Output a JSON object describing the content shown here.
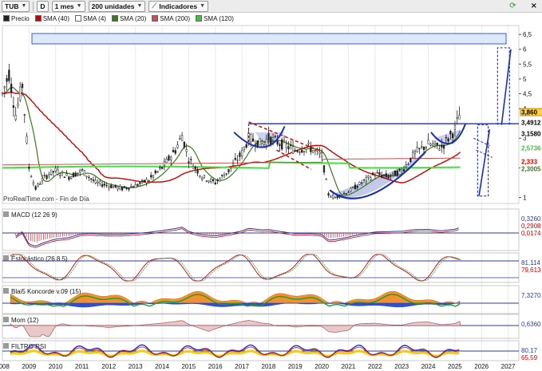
{
  "toolbar": {
    "symbol": "TUB",
    "d_button": "D",
    "period": "1 mes",
    "units": "200 unidades",
    "indicators": "Indicadores",
    "close_glyph": "×"
  },
  "legend": [
    {
      "label": "Precio",
      "color": "#222222"
    },
    {
      "label": "SMA (40)",
      "color": "#cc0000"
    },
    {
      "label": "SMA (4)",
      "color": "#ffffff"
    },
    {
      "label": "SMA (20)",
      "color": "#3a7a1a"
    },
    {
      "label": "SMA (200)",
      "color": "#c85050"
    },
    {
      "label": "SMA (120)",
      "color": "#40c040"
    }
  ],
  "watermark": "ProRealTime.com - Fin de Día",
  "price_axis": {
    "ticks": [
      "6,5",
      "6",
      "5,5",
      "5",
      "4,5",
      "4",
      "3",
      "2",
      "1"
    ],
    "labels": [
      {
        "text": "3,860",
        "color": "#000000",
        "bg": "#ffd040"
      },
      {
        "text": "3,4912",
        "color": "#000000",
        "bg": "#ffffff"
      },
      {
        "text": "3,1580",
        "color": "#000000",
        "bg": "#ffffff"
      },
      {
        "text": "2,5736",
        "color": "#40c040",
        "bg": "#ffffff"
      },
      {
        "text": "2,333",
        "color": "#cc0000",
        "bg": "#ffffff"
      },
      {
        "text": "2,3005",
        "color": "#3a7a1a",
        "bg": "#ffffff"
      }
    ]
  },
  "panels": {
    "macd": {
      "title": "MACD (12 26 9)",
      "labels": [
        "0,3260",
        "0,2908",
        "0,0174"
      ]
    },
    "stoch": {
      "title": "Estocástico (26 8 5)",
      "labels": [
        "81,114",
        "79,613"
      ]
    },
    "blai": {
      "title": "Blai5 Koncorde v.09 (15)",
      "labels": [
        "7,3270"
      ]
    },
    "mom": {
      "title": "Mom (12)",
      "labels": [
        "0,6360"
      ]
    },
    "rsi": {
      "title": "FILTRO RSI",
      "labels": [
        "80,17",
        "65,59"
      ]
    }
  },
  "x_axis": {
    "years": [
      "2008",
      "2009",
      "2010",
      "2011",
      "2012",
      "2013",
      "2014",
      "2015",
      "2016",
      "2017",
      "2018",
      "2019",
      "2020",
      "2021",
      "2022",
      "2023",
      "2024",
      "2025",
      "2026",
      "2027"
    ]
  },
  "chart_data": {
    "type": "line",
    "title": "TUB",
    "x": [
      2008.0,
      2008.25,
      2008.5,
      2008.75,
      2009.0,
      2009.25,
      2009.5,
      2009.75,
      2010.0,
      2010.5,
      2011.0,
      2011.5,
      2012.0,
      2012.5,
      2013.0,
      2013.5,
      2014.0,
      2014.5,
      2014.75,
      2015.0,
      2015.5,
      2016.0,
      2016.5,
      2017.0,
      2017.25,
      2017.5,
      2017.75,
      2018.0,
      2018.5,
      2019.0,
      2019.5,
      2020.0,
      2020.25,
      2020.5,
      2021.0,
      2021.5,
      2022.0,
      2022.5,
      2023.0,
      2023.5,
      2024.0,
      2024.5,
      2025.0,
      2025.2
    ],
    "series": [
      {
        "name": "Precio",
        "values": [
          4.5,
          5.2,
          3.8,
          4.8,
          2.0,
          1.3,
          1.6,
          1.8,
          1.9,
          1.7,
          1.9,
          1.5,
          1.4,
          1.3,
          1.4,
          1.6,
          2.0,
          2.6,
          3.1,
          2.3,
          1.7,
          1.5,
          1.9,
          2.5,
          3.0,
          2.9,
          2.8,
          3.0,
          2.8,
          2.6,
          2.7,
          2.4,
          1.1,
          1.0,
          1.2,
          1.5,
          1.8,
          1.7,
          1.9,
          2.5,
          2.8,
          2.7,
          3.3,
          3.86
        ]
      }
    ],
    "ylim": [
      0.8,
      6.8
    ],
    "xlim": [
      2008.0,
      2027.4
    ]
  }
}
